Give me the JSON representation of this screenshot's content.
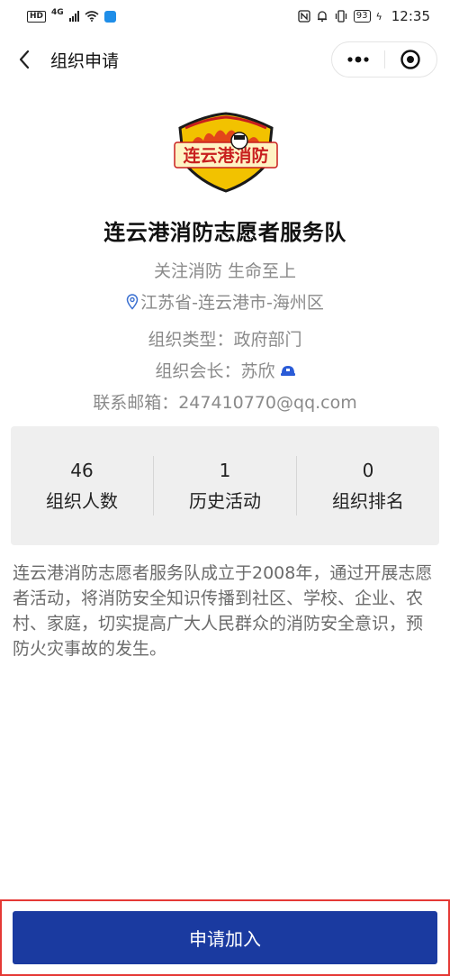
{
  "status_bar": {
    "hd": "HD",
    "network": "4G",
    "battery": "93",
    "time": "12:35"
  },
  "header": {
    "title": "组织申请"
  },
  "org": {
    "logo_text": "连云港消防",
    "name": "连云港消防志愿者服务队",
    "slogan": "关注消防 生命至上",
    "location": "江苏省-连云港市-海州区",
    "type": "组织类型：政府部门",
    "leader": "组织会长：苏欣",
    "email": "联系邮箱：247410770@qq.com"
  },
  "stats": [
    {
      "value": "46",
      "label": "组织人数"
    },
    {
      "value": "1",
      "label": "历史活动"
    },
    {
      "value": "0",
      "label": "组织排名"
    }
  ],
  "description": "连云港消防志愿者服务队成立于2008年，通过开展志愿者活动，将消防安全知识传播到社区、学校、企业、农村、家庭，切实提高广大人民群众的消防安全意识，预防火灾事故的发生。",
  "join_button": {
    "label": "申请加入"
  },
  "colors": {
    "primary_button": "#1a3aa0",
    "highlight_border": "#e53935",
    "logo_shield": "#f2c200",
    "logo_text": "#c81e1e"
  }
}
